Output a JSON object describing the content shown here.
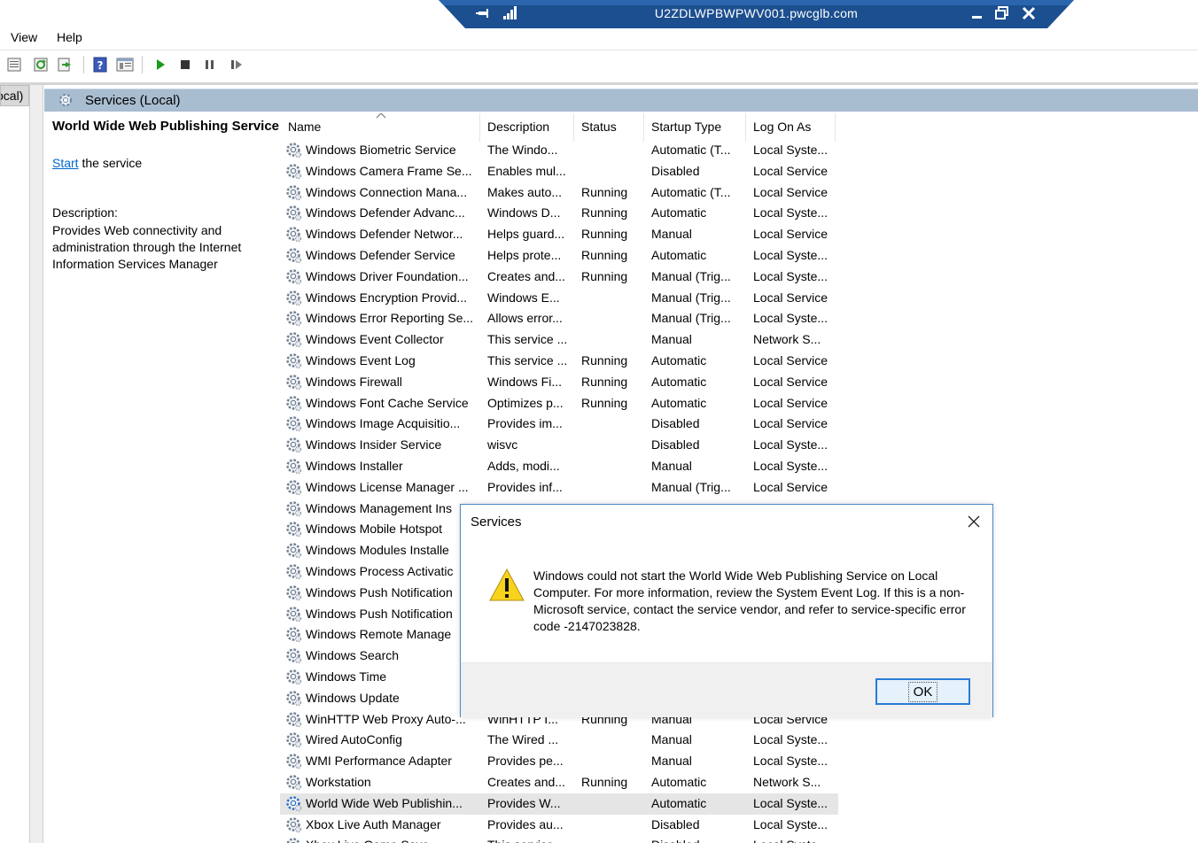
{
  "rdp_bar": {
    "title": "U2ZDLWPBWPWV001.pwcglb.com"
  },
  "menu": {
    "items": [
      "View",
      "Help"
    ]
  },
  "tree": {
    "item_label": "ocal)"
  },
  "pane_header": {
    "title": "Services (Local)"
  },
  "description": {
    "service_name": "World Wide Web Publishing Service",
    "start_link": "Start",
    "start_suffix": " the service",
    "label": "Description:",
    "text": "Provides Web connectivity and administration through the Internet Information Services Manager"
  },
  "columns": [
    "Name",
    "Description",
    "Status",
    "Startup Type",
    "Log On As"
  ],
  "services": [
    {
      "name": "Windows Biometric Service",
      "description": "The Windo...",
      "status": "",
      "startup": "Automatic (T...",
      "logon": "Local Syste..."
    },
    {
      "name": "Windows Camera Frame Se...",
      "description": "Enables mul...",
      "status": "",
      "startup": "Disabled",
      "logon": "Local Service"
    },
    {
      "name": "Windows Connection Mana...",
      "description": "Makes auto...",
      "status": "Running",
      "startup": "Automatic (T...",
      "logon": "Local Service"
    },
    {
      "name": "Windows Defender Advanc...",
      "description": "Windows D...",
      "status": "Running",
      "startup": "Automatic",
      "logon": "Local Syste..."
    },
    {
      "name": "Windows Defender Networ...",
      "description": "Helps guard...",
      "status": "Running",
      "startup": "Manual",
      "logon": "Local Service"
    },
    {
      "name": "Windows Defender Service",
      "description": "Helps prote...",
      "status": "Running",
      "startup": "Automatic",
      "logon": "Local Syste..."
    },
    {
      "name": "Windows Driver Foundation...",
      "description": "Creates and...",
      "status": "Running",
      "startup": "Manual (Trig...",
      "logon": "Local Syste..."
    },
    {
      "name": "Windows Encryption Provid...",
      "description": "Windows E...",
      "status": "",
      "startup": "Manual (Trig...",
      "logon": "Local Service"
    },
    {
      "name": "Windows Error Reporting Se...",
      "description": "Allows error...",
      "status": "",
      "startup": "Manual (Trig...",
      "logon": "Local Syste..."
    },
    {
      "name": "Windows Event Collector",
      "description": "This service ...",
      "status": "",
      "startup": "Manual",
      "logon": "Network S..."
    },
    {
      "name": "Windows Event Log",
      "description": "This service ...",
      "status": "Running",
      "startup": "Automatic",
      "logon": "Local Service"
    },
    {
      "name": "Windows Firewall",
      "description": "Windows Fi...",
      "status": "Running",
      "startup": "Automatic",
      "logon": "Local Service"
    },
    {
      "name": "Windows Font Cache Service",
      "description": "Optimizes p...",
      "status": "Running",
      "startup": "Automatic",
      "logon": "Local Service"
    },
    {
      "name": "Windows Image Acquisitio...",
      "description": "Provides im...",
      "status": "",
      "startup": "Disabled",
      "logon": "Local Service"
    },
    {
      "name": "Windows Insider Service",
      "description": "wisvc",
      "status": "",
      "startup": "Disabled",
      "logon": "Local Syste..."
    },
    {
      "name": "Windows Installer",
      "description": "Adds, modi...",
      "status": "",
      "startup": "Manual",
      "logon": "Local Syste..."
    },
    {
      "name": "Windows License Manager ...",
      "description": "Provides inf...",
      "status": "",
      "startup": "Manual (Trig...",
      "logon": "Local Service"
    },
    {
      "name": "Windows Management Ins",
      "description": "",
      "status": "",
      "startup": "",
      "logon": ""
    },
    {
      "name": "Windows Mobile Hotspot",
      "description": "",
      "status": "",
      "startup": "",
      "logon": ""
    },
    {
      "name": "Windows Modules Installe",
      "description": "",
      "status": "",
      "startup": "",
      "logon": ""
    },
    {
      "name": "Windows Process Activatic",
      "description": "",
      "status": "",
      "startup": "",
      "logon": ""
    },
    {
      "name": "Windows Push Notification",
      "description": "",
      "status": "",
      "startup": "",
      "logon": ""
    },
    {
      "name": "Windows Push Notification",
      "description": "",
      "status": "",
      "startup": "",
      "logon": ""
    },
    {
      "name": "Windows Remote Manage",
      "description": "",
      "status": "",
      "startup": "",
      "logon": ""
    },
    {
      "name": "Windows Search",
      "description": "",
      "status": "",
      "startup": "",
      "logon": ""
    },
    {
      "name": "Windows Time",
      "description": "",
      "status": "",
      "startup": "",
      "logon": ""
    },
    {
      "name": "Windows Update",
      "description": "",
      "status": "",
      "startup": "",
      "logon": ""
    },
    {
      "name": "WinHTTP Web Proxy Auto-...",
      "description": "WinHTTP I...",
      "status": "Running",
      "startup": "Manual",
      "logon": "Local Service"
    },
    {
      "name": "Wired AutoConfig",
      "description": "The Wired ...",
      "status": "",
      "startup": "Manual",
      "logon": "Local Syste..."
    },
    {
      "name": "WMI Performance Adapter",
      "description": "Provides pe...",
      "status": "",
      "startup": "Manual",
      "logon": "Local Syste..."
    },
    {
      "name": "Workstation",
      "description": "Creates and...",
      "status": "Running",
      "startup": "Automatic",
      "logon": "Network S..."
    },
    {
      "name": "World Wide Web Publishin...",
      "description": "Provides W...",
      "status": "",
      "startup": "Automatic",
      "logon": "Local Syste...",
      "selected": true
    },
    {
      "name": "Xbox Live Auth Manager",
      "description": "Provides au...",
      "status": "",
      "startup": "Disabled",
      "logon": "Local Syste..."
    },
    {
      "name": "Xbox Live Game Save",
      "description": "This service",
      "status": "",
      "startup": "Disabled",
      "logon": "Local Syste..."
    }
  ],
  "dialog": {
    "title": "Services",
    "message": "Windows could not start the World Wide Web Publishing Service on Local Computer. For more information, review the System Event Log. If this is a non-Microsoft service, contact the service vendor, and refer to service-specific error code -2147023828.",
    "ok_label": "OK"
  },
  "colors": {
    "rdp_bar": "#1c4f8f",
    "pane_header": "#a9bdd1",
    "link": "#0066cc",
    "dialog_border": "#4a87c7",
    "ok_border": "#2a7bd6",
    "warning": "#f8d31c"
  }
}
